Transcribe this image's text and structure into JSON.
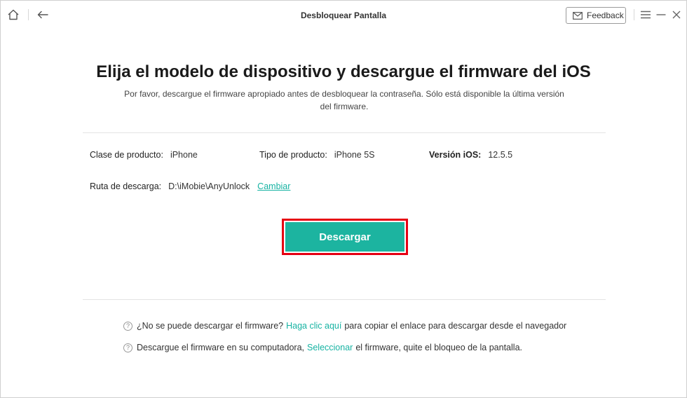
{
  "window": {
    "title": "Desbloquear Pantalla",
    "feedback_label": "Feedback"
  },
  "header": {
    "title": "Elija el modelo de dispositivo y descargue el firmware del iOS",
    "subtitle": "Por favor, descargue el firmware apropiado antes de desbloquear la contraseña. Sólo está disponible la última versión del firmware."
  },
  "device": {
    "product_class_label": "Clase de producto:",
    "product_class_value": "iPhone",
    "product_type_label": "Tipo de producto:",
    "product_type_value": "iPhone 5S",
    "ios_version_label": "Versión iOS:",
    "ios_version_value": "12.5.5",
    "download_path_label": "Ruta de descarga:",
    "download_path_value": "D:\\iMobie\\AnyUnlock",
    "change_link": "Cambiar"
  },
  "actions": {
    "download_label": "Descargar"
  },
  "help": {
    "row1_prefix": "¿No se puede descargar el firmware?",
    "row1_link": "Haga clic aquí",
    "row1_suffix": "para copiar el enlace para descargar desde el navegador",
    "row2_prefix": "Descargue el firmware en su computadora,",
    "row2_link": "Seleccionar",
    "row2_suffix": "el firmware, quite el bloqueo de la pantalla."
  },
  "colors": {
    "accent": "#1cb4a0",
    "highlight": "#e60012"
  },
  "icons": [
    "home-icon",
    "back-arrow-icon",
    "mail-icon",
    "menu-icon",
    "minimize-icon",
    "close-icon",
    "question-icon"
  ]
}
